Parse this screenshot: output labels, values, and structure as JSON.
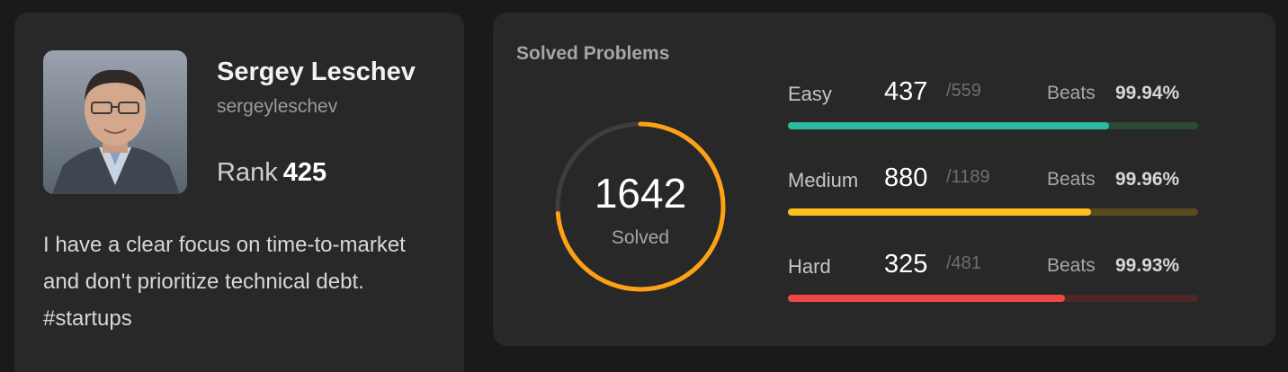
{
  "profile": {
    "name": "Sergey Leschev",
    "username": "sergeyleschev",
    "rank_label": "Rank",
    "rank_value": "425",
    "bio": "I have a clear focus on time-to-market and don't prioritize technical debt. #startups"
  },
  "stats": {
    "title": "Solved Problems",
    "total_solved": "1642",
    "solved_label": "Solved",
    "ring_color": "#ffa116",
    "ring_track_color": "#3e3e3e",
    "difficulties": [
      {
        "label": "Easy",
        "solved": "437",
        "total": "/559",
        "beats_label": "Beats",
        "beats": "99.94%",
        "progress": 0.7818,
        "color": "#2cbb9f",
        "track_color": "#2a4a33"
      },
      {
        "label": "Medium",
        "solved": "880",
        "total": "/1189",
        "beats_label": "Beats",
        "beats": "99.96%",
        "progress": 0.7401,
        "color": "#ffc01e",
        "track_color": "#5a4a1f"
      },
      {
        "label": "Hard",
        "solved": "325",
        "total": "/481",
        "beats_label": "Beats",
        "beats": "99.93%",
        "progress": 0.6757,
        "color": "#ef4743",
        "track_color": "#4d2626"
      }
    ]
  }
}
